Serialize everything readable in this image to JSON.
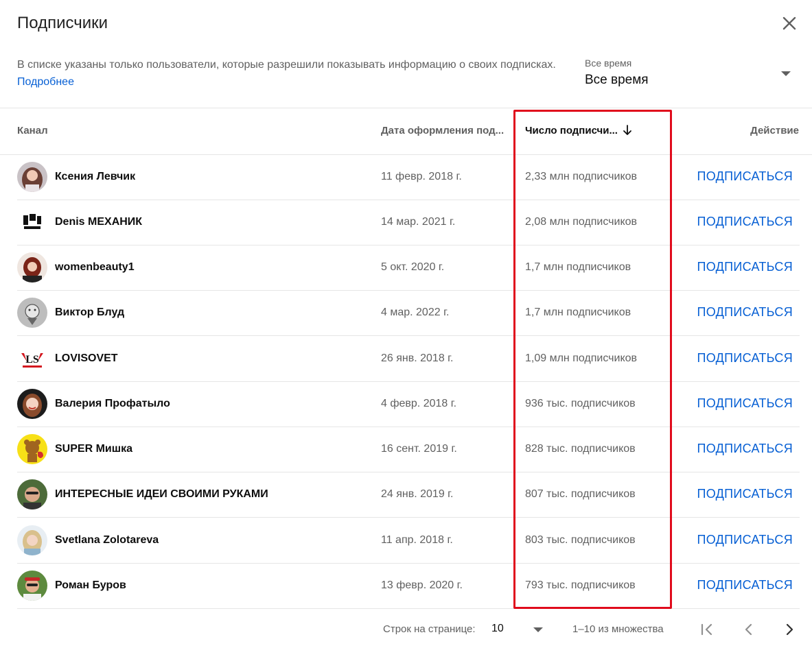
{
  "dialog": {
    "title": "Подписчики",
    "info_text": "В списке указаны только пользователи, которые разрешили показывать информацию о своих подписках.",
    "more_link": "Подробнее",
    "period_label": "Все время",
    "period_value": "Все время"
  },
  "table": {
    "headers": {
      "channel": "Канал",
      "date": "Дата оформления под...",
      "subscribers": "Число подписчи...",
      "action": "Действие"
    },
    "rows": [
      {
        "name": "Ксения Левчик",
        "date": "11 февр. 2018 г.",
        "subs": "2,33 млн подписчиков",
        "action": "ПОДПИСАТЬСЯ"
      },
      {
        "name": "Denis МЕХАНИК",
        "date": "14 мар. 2021 г.",
        "subs": "2,08 млн подписчиков",
        "action": "ПОДПИСАТЬСЯ"
      },
      {
        "name": "womenbeauty1",
        "date": "5 окт. 2020 г.",
        "subs": "1,7 млн подписчиков",
        "action": "ПОДПИСАТЬСЯ"
      },
      {
        "name": "Виктор Блуд",
        "date": "4 мар. 2022 г.",
        "subs": "1,7 млн подписчиков",
        "action": "ПОДПИСАТЬСЯ"
      },
      {
        "name": "LOVISOVET",
        "date": "26 янв. 2018 г.",
        "subs": "1,09 млн подписчиков",
        "action": "ПОДПИСАТЬСЯ"
      },
      {
        "name": "Валерия Профатыло",
        "date": "4 февр. 2018 г.",
        "subs": "936 тыс. подписчиков",
        "action": "ПОДПИСАТЬСЯ"
      },
      {
        "name": "SUPER Мишка",
        "date": "16 сент. 2019 г.",
        "subs": "828 тыс. подписчиков",
        "action": "ПОДПИСАТЬСЯ"
      },
      {
        "name": "ИНТЕРЕСНЫЕ ИДЕИ СВОИМИ РУКАМИ",
        "date": "24 янв. 2019 г.",
        "subs": "807 тыс. подписчиков",
        "action": "ПОДПИСАТЬСЯ"
      },
      {
        "name": "Svetlana Zolotareva",
        "date": "11 апр. 2018 г.",
        "subs": "803 тыс. подписчиков",
        "action": "ПОДПИСАТЬСЯ"
      },
      {
        "name": "Роман Буров",
        "date": "13 февр. 2020 г.",
        "subs": "793 тыс. подписчиков",
        "action": "ПОДПИСАТЬСЯ"
      }
    ]
  },
  "footer": {
    "rows_per_page_label": "Строк на странице:",
    "rows_per_page_value": "10",
    "range_text": "1–10 из множества"
  },
  "colors": {
    "link_blue": "#065fd4",
    "highlight_red": "#e00b1c"
  }
}
